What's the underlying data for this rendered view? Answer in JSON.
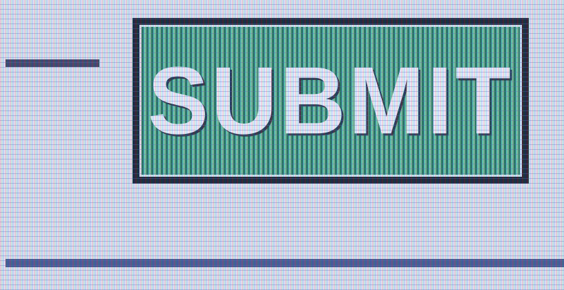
{
  "button": {
    "label": "SUBMIT"
  },
  "colors": {
    "background": "#dde6f0",
    "button_fill": "#3fae86",
    "button_border": "#0c1420",
    "label": "#eaf2fb",
    "divider": "#3d4f86"
  }
}
